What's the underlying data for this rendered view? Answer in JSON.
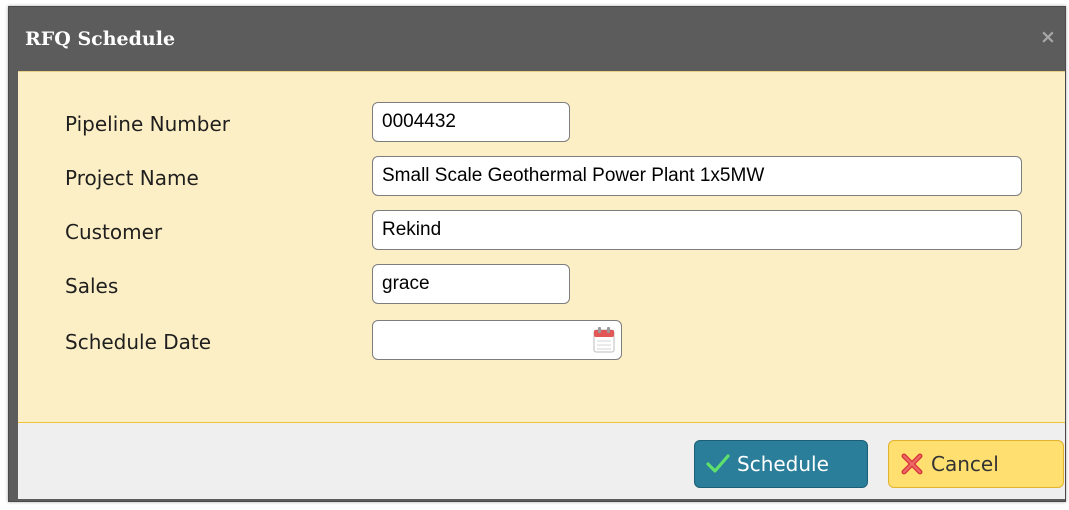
{
  "dialog": {
    "title": "RFQ Schedule",
    "close_icon": "close-icon"
  },
  "form": {
    "fields": [
      {
        "label": "Pipeline Number",
        "value": "0004432"
      },
      {
        "label": "Project Name",
        "value": "Small Scale Geothermal Power Plant 1x5MW"
      },
      {
        "label": "Customer",
        "value": "Rekind"
      },
      {
        "label": "Sales",
        "value": "grace"
      },
      {
        "label": "Schedule Date",
        "value": ""
      }
    ],
    "calendar_icon": "calendar-icon"
  },
  "footer": {
    "schedule_label": "Schedule",
    "schedule_icon": "check-icon",
    "cancel_label": "Cancel",
    "cancel_icon": "x-icon"
  },
  "colors": {
    "titlebar": "#5c5c5c",
    "content_bg": "#fdefc5",
    "footer_bg": "#efefef",
    "schedule_button": "#2a7e9a",
    "cancel_button": "#ffdf70"
  }
}
